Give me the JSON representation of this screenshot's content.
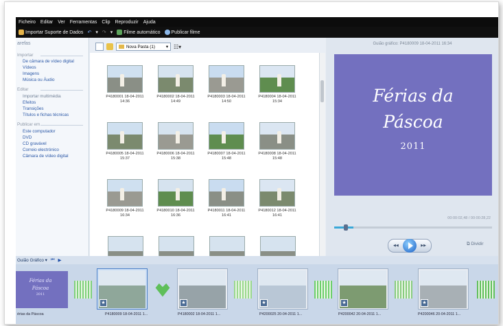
{
  "menu": [
    "Ficheiro",
    "Editar",
    "Ver",
    "Ferramentas",
    "Clip",
    "Reproduzir",
    "Ajuda"
  ],
  "toolbar": {
    "import": "Importar Suporte de Dados",
    "auto_movie": "Filme automático",
    "publish": "Publicar filme"
  },
  "tasks": {
    "header": "arefas",
    "import_group": "Importar",
    "import_items": [
      "De câmara de vídeo digital",
      "Vídeos",
      "Imagens",
      "Música ou Áudio"
    ],
    "edit_group": "Editar",
    "edit_items": [
      "Importar multimédia",
      "Efeitos",
      "Transições",
      "Títulos e fichas técnicas"
    ],
    "publish_group": "Publicar em",
    "publish_items": [
      "Este computador",
      "DVD",
      "CD gravável",
      "Correio electrónico",
      "Câmara de vídeo digital"
    ]
  },
  "collection": {
    "folder": "Nova Pasta (1)",
    "clips": [
      {
        "name": "P4180001 18-04-2011",
        "time": "14:36"
      },
      {
        "name": "P4180002 18-04-2011",
        "time": "14:49"
      },
      {
        "name": "P4180003 18-04-2011",
        "time": "14:50"
      },
      {
        "name": "P4180004 18-04-2011",
        "time": "15:34"
      },
      {
        "name": "P4180005 18-04-2011",
        "time": "15:37"
      },
      {
        "name": "P4180006 18-04-2011",
        "time": "15:38"
      },
      {
        "name": "P4180007 18-04-2011",
        "time": "15:48"
      },
      {
        "name": "P4180008 18-04-2011",
        "time": "15:48"
      },
      {
        "name": "P4180009 18-04-2011",
        "time": "16:34"
      },
      {
        "name": "P4180010 18-04-2011",
        "time": "16:36"
      },
      {
        "name": "P4180011 18-04-2011",
        "time": "16:41"
      },
      {
        "name": "P4180012 18-04-2011",
        "time": "16:41"
      }
    ]
  },
  "preview": {
    "title": "Guião gráfico: P4180009 18-04-2011 16:34",
    "line1": "Férias da",
    "line2": "Páscoa",
    "line3": "2011",
    "time": "00:00:02,48 / 00:00:28,22",
    "split": "Dividir"
  },
  "timeline": {
    "view_label": "Guião Gráfico",
    "title_tile": [
      "Férias da",
      "Páscoa",
      "2011"
    ],
    "labels": [
      "érias da Páscoa",
      "P4180009 18-04-2011 1...",
      "P4180002 18-04-2011 1...",
      "P4200025 20-04-2011 1...",
      "P4200042 20-04-2011 1...",
      "P4200046 20-04-2011 1..."
    ]
  },
  "colors": {
    "title_bg": "#7370bf",
    "menubar": "#0c0c0c",
    "accent": "#2a57a6"
  }
}
